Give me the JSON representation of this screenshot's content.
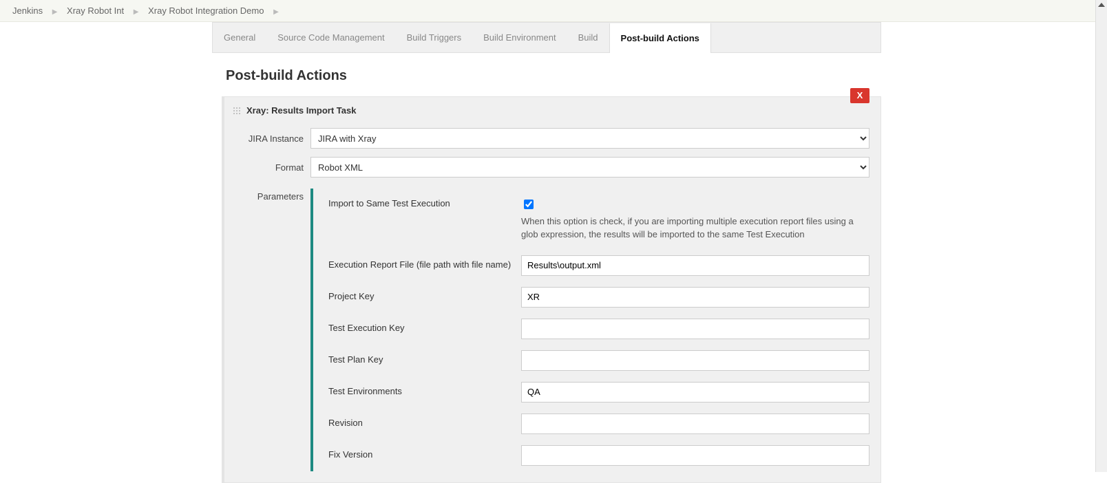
{
  "breadcrumb": {
    "items": [
      "Jenkins",
      "Xray Robot Int",
      "Xray Robot Integration Demo"
    ]
  },
  "tabs": {
    "general": "General",
    "scm": "Source Code Management",
    "triggers": "Build Triggers",
    "env": "Build Environment",
    "build": "Build",
    "postbuild": "Post-build Actions"
  },
  "section": {
    "title": "Post-build Actions"
  },
  "task": {
    "title": "Xray: Results Import Task",
    "delete_label": "X",
    "jira_label": "JIRA Instance",
    "jira_value": "JIRA with Xray",
    "format_label": "Format",
    "format_value": "Robot XML",
    "params_label": "Parameters",
    "params": {
      "import_same_label": "Import to Same Test Execution",
      "import_same_checked": true,
      "import_same_help": "When this option is check, if you are importing multiple execution report files using a glob expression, the results will be imported to the same Test Execution",
      "report_file_label": "Execution Report File (file path with file name)",
      "report_file_value": "Results\\output.xml",
      "project_key_label": "Project Key",
      "project_key_value": "XR",
      "test_exec_key_label": "Test Execution Key",
      "test_exec_key_value": "",
      "test_plan_key_label": "Test Plan Key",
      "test_plan_key_value": "",
      "test_env_label": "Test Environments",
      "test_env_value": "QA",
      "revision_label": "Revision",
      "revision_value": "",
      "fix_version_label": "Fix Version",
      "fix_version_value": ""
    }
  }
}
